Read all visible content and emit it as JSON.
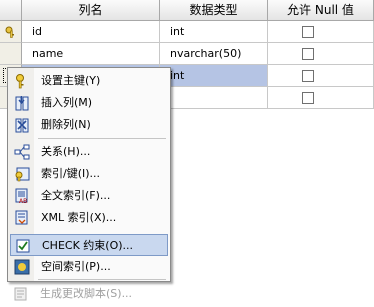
{
  "table": {
    "headers": [
      "列名",
      "数据类型",
      "允许 Null 值"
    ],
    "rows": [
      {
        "name": "id",
        "type": "int"
      },
      {
        "name": "name",
        "type": "nvarchar(50)"
      },
      {
        "name": "",
        "type": "int"
      },
      {
        "name": "",
        "type": ""
      }
    ]
  },
  "menu": {
    "items": [
      {
        "label": "设置主键(Y)",
        "icon": "primary-key-icon"
      },
      {
        "label": "插入列(M)",
        "icon": "insert-column-icon"
      },
      {
        "label": "删除列(N)",
        "icon": "delete-column-icon"
      },
      {
        "label": "关系(H)...",
        "icon": "relationships-icon"
      },
      {
        "label": "索引/键(I)...",
        "icon": "index-key-icon"
      },
      {
        "label": "全文索引(F)...",
        "icon": "fulltext-index-icon"
      },
      {
        "label": "XML 索引(X)...",
        "icon": "xml-index-icon"
      },
      {
        "label": "CHECK 约束(O)...",
        "icon": "check-constraint-icon"
      },
      {
        "label": "空间索引(P)...",
        "icon": "spatial-index-icon"
      },
      {
        "label": "生成更改脚本(S)...",
        "icon": "generate-script-icon"
      }
    ]
  },
  "colors": {
    "menu_highlight": "#c9d8ef",
    "row_selected": "#b5c4e4"
  }
}
